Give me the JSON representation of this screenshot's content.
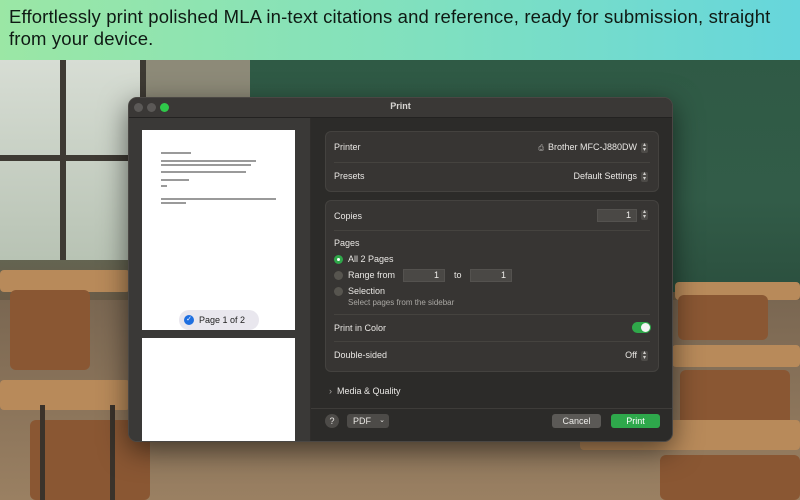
{
  "banner": {
    "text": "Effortlessly print polished MLA in-text citations and reference, ready for submission, straight from your device."
  },
  "dialog": {
    "title": "Print",
    "preview": {
      "page_indicator": "Page 1 of 2"
    },
    "printer": {
      "label": "Printer",
      "value": "Brother MFC-J880DW",
      "icon": "printer-icon"
    },
    "presets": {
      "label": "Presets",
      "value": "Default Settings"
    },
    "copies": {
      "label": "Copies",
      "value": "1"
    },
    "pages": {
      "label": "Pages",
      "all_label": "All 2 Pages",
      "range_label": "Range from",
      "range_from": "1",
      "range_to_label": "to",
      "range_to": "1",
      "selection_label": "Selection",
      "selection_hint": "Select pages from the sidebar"
    },
    "print_in_color": {
      "label": "Print in Color",
      "on": true
    },
    "double_sided": {
      "label": "Double-sided",
      "value": "Off"
    },
    "media_quality": {
      "label": "Media & Quality"
    },
    "help": "?",
    "pdf": "PDF",
    "cancel": "Cancel",
    "print": "Print"
  },
  "colors": {
    "accent": "#2ea84b",
    "banner_start": "#9be7a5",
    "banner_end": "#66d6dc"
  }
}
